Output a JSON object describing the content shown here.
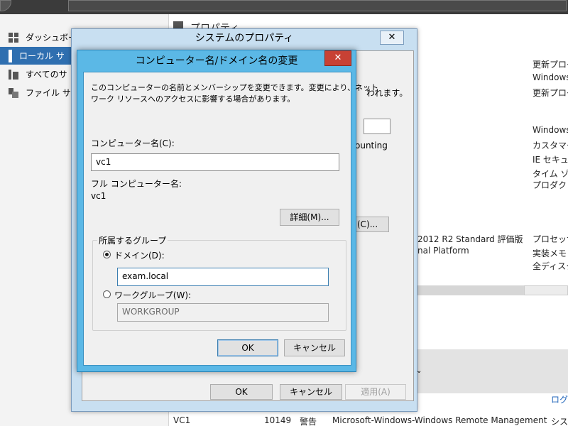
{
  "server_manager": {
    "header_title": "プロパティ",
    "sidebar": {
      "items": [
        {
          "label": "ダッシュボー",
          "selected": false,
          "icon": "dashboard-icon"
        },
        {
          "label": "ローカル サ",
          "selected": true,
          "icon": "local-server-icon"
        },
        {
          "label": "すべてのサ",
          "selected": false,
          "icon": "all-servers-icon"
        },
        {
          "label": "ファイル サ",
          "selected": false,
          "icon": "file-services-icon"
        }
      ]
    },
    "right_column": {
      "group1": [
        "更新プログ",
        "Windows",
        "更新プログ"
      ],
      "group2": [
        "Windows",
        "カスタマー",
        "IE セキュリ",
        "タイム ゾー",
        "プロダクト I"
      ],
      "group3": [
        "プロセッサ",
        "実装メモリ",
        "全ディスク領"
      ]
    },
    "middle_fragments": {
      "edition": "2012 R2 Standard 評価版",
      "platform": "nal Platform",
      "accounting": "ounting",
      "message_tail": "われます。",
      "change_button_tail": "(C)..."
    },
    "log_link": "ログ",
    "event_row": {
      "server": "VC1",
      "id": "10149",
      "level": "警告",
      "source": "Microsoft-Windows-Windows Remote Management",
      "category": "シス"
    }
  },
  "system_properties": {
    "title": "システムのプロパティ",
    "close_label": "✕",
    "ok_label": "OK",
    "cancel_label": "キャンセル",
    "apply_label": "適用(A)"
  },
  "computer_name_dialog": {
    "title": "コンピューター名/ドメイン名の変更",
    "close_label": "✕",
    "description_line1": "このコンピューターの名前とメンバーシップを変更できます。変更により、ネット",
    "description_line2": "ワーク リソースへのアクセスに影響する場合があります。",
    "computer_name_label": "コンピューター名(C):",
    "computer_name_value": "vc1",
    "full_name_label": "フル コンピューター名:",
    "full_name_value": "vc1",
    "details_button": "詳細(M)...",
    "member_of_legend": "所属するグループ",
    "domain_radio_label": "ドメイン(D):",
    "domain_value": "exam.local",
    "workgroup_radio_label": "ワークグループ(W):",
    "workgroup_value": "WORKGROUP",
    "ok_label": "OK",
    "cancel_label": "キャンセル",
    "selected_membership": "domain"
  }
}
